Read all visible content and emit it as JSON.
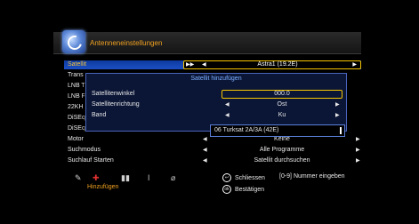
{
  "header": {
    "title": "Antenneneinstellungen",
    "icon": "satellite-dish-icon"
  },
  "menu": {
    "items": [
      {
        "label": "Satellit",
        "value": "Astra1 (19.2E)"
      },
      {
        "label": "Trans",
        "value": ""
      },
      {
        "label": "LNB T",
        "value": ""
      },
      {
        "label": "LNB F",
        "value": ""
      },
      {
        "label": "22KH",
        "value": ""
      },
      {
        "label": "DiSEq",
        "value": ""
      },
      {
        "label": "DiSEqC1.1",
        "value": ""
      },
      {
        "label": "Motor",
        "value": "Keine"
      },
      {
        "label": "Suchmodus",
        "value": "Alle Programme"
      },
      {
        "label": "Suchlauf Starten",
        "value": "Satellit durchsuchen"
      }
    ]
  },
  "dialog": {
    "title": "Satellit hinzufügen",
    "rows": [
      {
        "label": "Satellitenwinkel",
        "value": "000.0"
      },
      {
        "label": "Satellitenrichtung",
        "value": "Ost"
      },
      {
        "label": "Band",
        "value": "Ku"
      }
    ]
  },
  "dropdown": {
    "value": "06  Turksat 2A/3A (42E)"
  },
  "toolbar": {
    "add_label": "Hinzufügen",
    "close_hint": "Schliessen",
    "number_hint": "[0-9]  Nummer eingeben",
    "confirm_hint": "Bestätigen"
  },
  "colors": {
    "accent": "#f0a020",
    "selection": "#1c4fc4",
    "focus_border": "#f5c400"
  }
}
